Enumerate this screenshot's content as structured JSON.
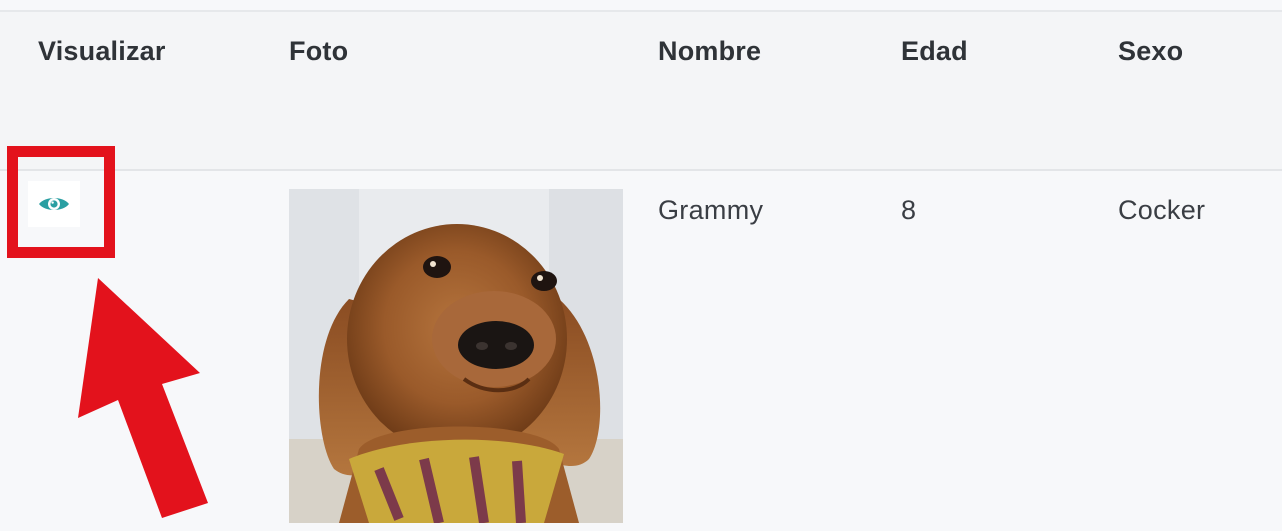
{
  "table": {
    "columns": [
      "Visualizar",
      "Foto",
      "Nombre",
      "Edad",
      "Sexo"
    ],
    "rows": [
      {
        "view_icon": "eye-icon",
        "photo": "dog-photo",
        "nombre": "Grammy",
        "edad": "8",
        "sexo": "Cocker"
      }
    ]
  },
  "annotation": {
    "highlight_color": "#e3121c",
    "arrow_color": "#e3121c"
  },
  "colors": {
    "eye_icon": "#2a9fa2",
    "header_text": "#2f3338",
    "cell_text": "#3a3e44"
  }
}
